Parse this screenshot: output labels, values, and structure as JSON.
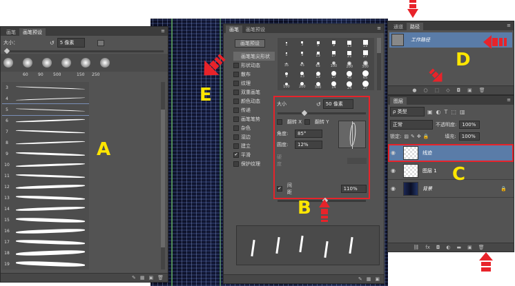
{
  "panel_a": {
    "tabs": [
      "画笔",
      "画笔预设"
    ],
    "size_label": "大小：",
    "size_value": "5 像素",
    "preset_sizes": [
      "60",
      "90",
      "500",
      "150",
      "250"
    ],
    "stroke_numbers": [
      "3",
      "4",
      "5",
      "6",
      "7",
      "8",
      "9",
      "10",
      "11",
      "12",
      "13",
      "14",
      "15",
      "16",
      "17",
      "18",
      "19"
    ],
    "marker": "A"
  },
  "panel_b": {
    "tabs": [
      "画笔",
      "画笔预设"
    ],
    "preset_button": "画笔预设",
    "categories": [
      {
        "label": "画笔笔尖形状",
        "checked": false,
        "active": true
      },
      {
        "label": "形状动态",
        "checked": false
      },
      {
        "label": "散布",
        "checked": false
      },
      {
        "label": "纹理",
        "checked": false
      },
      {
        "label": "双重画笔",
        "checked": false
      },
      {
        "label": "颜色动态",
        "checked": false
      },
      {
        "label": "传递",
        "checked": false
      },
      {
        "label": "画笔笔势",
        "checked": false
      },
      {
        "label": "杂色",
        "checked": false
      },
      {
        "label": "湿边",
        "checked": false
      },
      {
        "label": "建立",
        "checked": false
      },
      {
        "label": "平滑",
        "checked": true
      },
      {
        "label": "保护纹理",
        "checked": false
      }
    ],
    "tip_numbers": [
      "1",
      "3",
      "5",
      "9",
      "13",
      "19",
      "5",
      "9",
      "13",
      "17",
      "21",
      "27",
      "35",
      "45",
      "65",
      "100",
      "200",
      "300",
      "9",
      "13",
      "19",
      "17",
      "45",
      "65",
      "100",
      "200",
      "300",
      "14",
      "24",
      "27",
      "39",
      "46",
      "59"
    ],
    "size_label": "大小",
    "size_value": "50 像素",
    "flip_x": "翻转 X",
    "flip_y": "翻转 Y",
    "angle_label": "角度:",
    "angle_value": "85°",
    "roundness_label": "圆度:",
    "roundness_value": "12%",
    "hardness_label": "硬度",
    "spacing_label": "间距",
    "spacing_value": "110%",
    "spacing_checked": true,
    "marker_b": "B",
    "marker_e": "E"
  },
  "panel_d": {
    "tabs": [
      "通道",
      "路径"
    ],
    "path_name": "工作路径",
    "marker": "D"
  },
  "panel_c": {
    "tab": "图层",
    "filter_label": "ρ 类型",
    "blend_mode": "正常",
    "opacity_label": "不透明度:",
    "opacity_value": "100%",
    "lock_label": "锁定:",
    "fill_label": "填充:",
    "fill_value": "100%",
    "layers": [
      {
        "name": "线迹",
        "selected": true,
        "italic": false
      },
      {
        "name": "图层 1",
        "selected": false,
        "italic": false
      },
      {
        "name": "背景",
        "selected": false,
        "italic": true
      }
    ],
    "marker": "C"
  },
  "colors": {
    "panel": "#535353",
    "dark": "#3c3c3c",
    "selected": "#5a7ca8",
    "marker": "#ffe600",
    "arrow": "#e8232a",
    "highlight": "#e8232a"
  }
}
